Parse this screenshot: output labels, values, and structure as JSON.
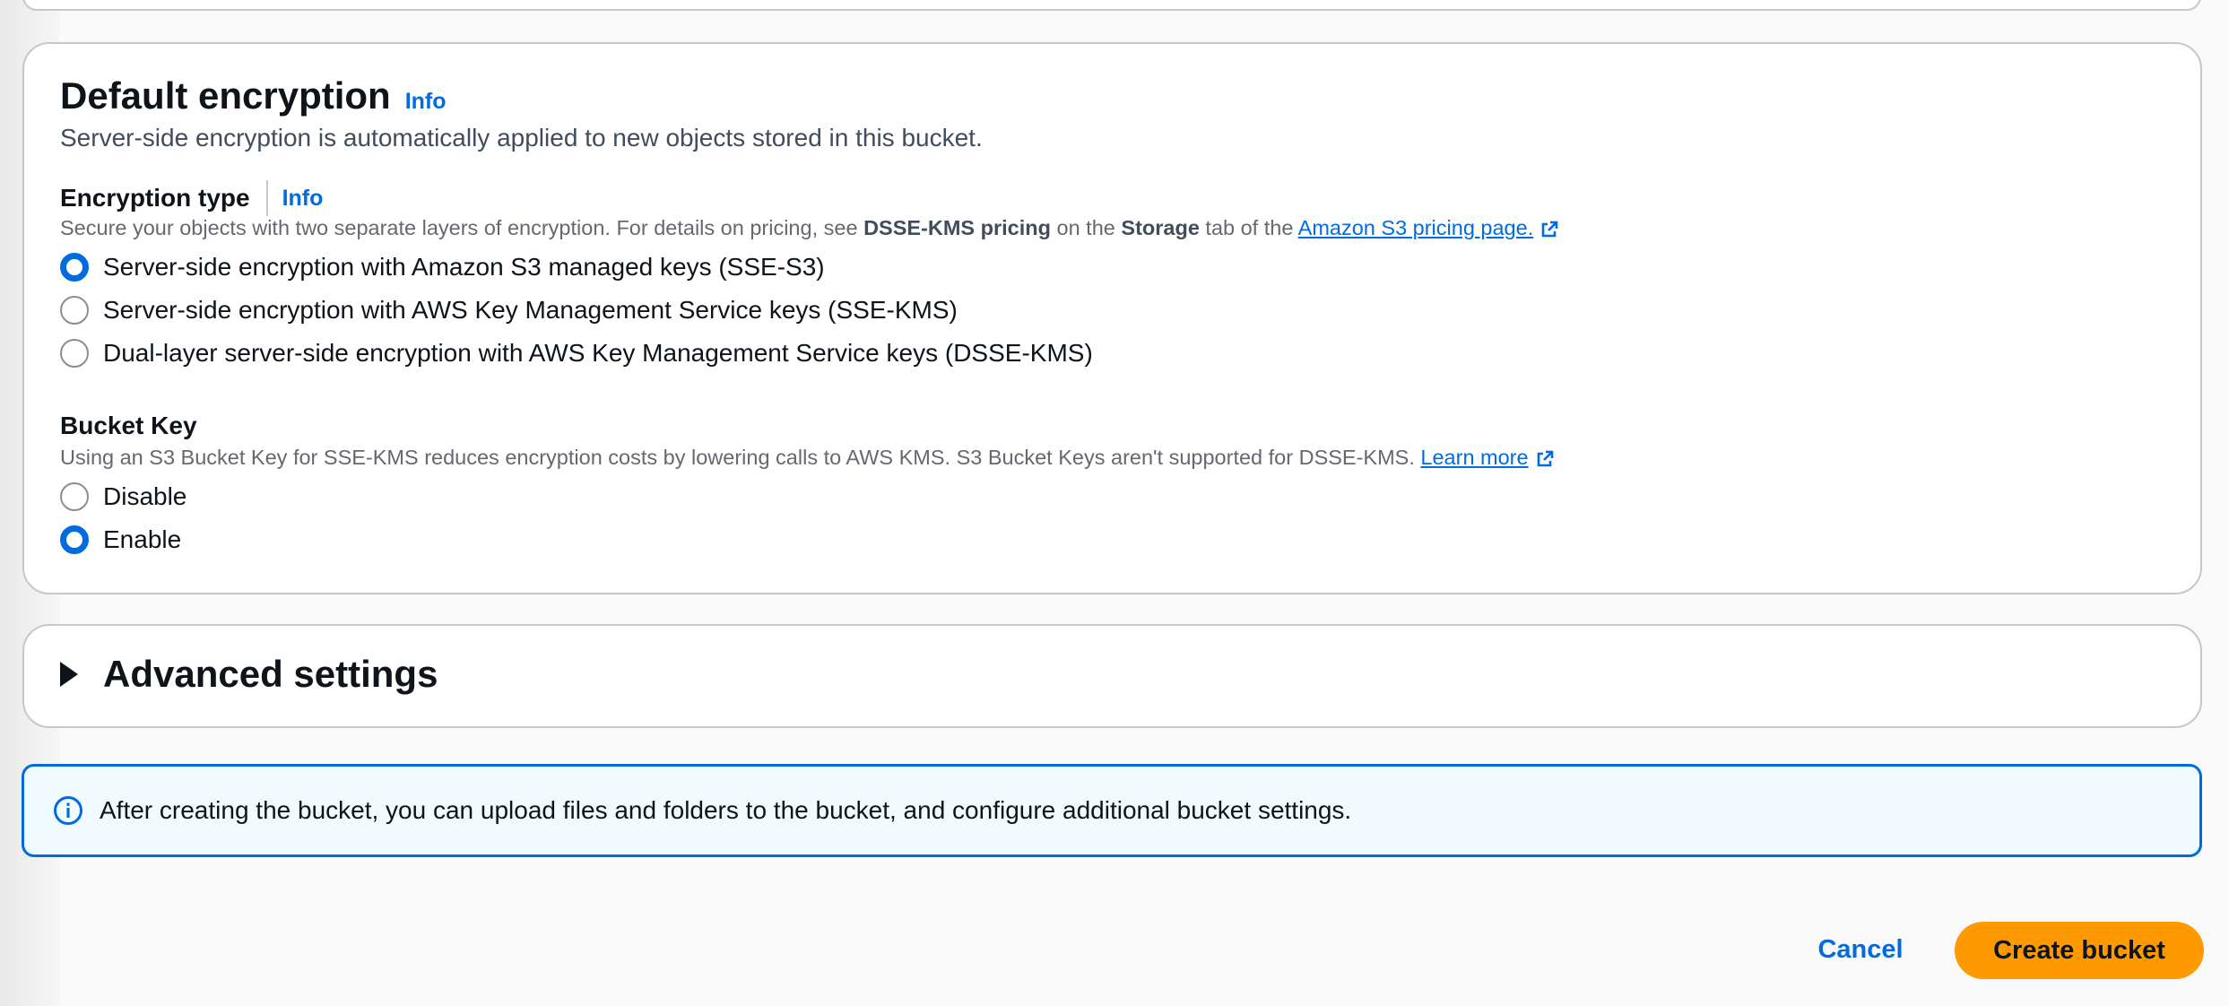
{
  "encryption": {
    "title": "Default encryption",
    "info": "Info",
    "description": "Server-side encryption is automatically applied to new objects stored in this bucket.",
    "type_label": "Encryption type",
    "type_info": "Info",
    "type_desc": {
      "part1": "Secure your objects with two separate layers of encryption. For details on pricing, see ",
      "bold1": "DSSE-KMS pricing",
      "part2": " on the ",
      "bold2": "Storage",
      "part3": " tab of the ",
      "link": "Amazon S3 pricing page."
    },
    "options": [
      {
        "label": "Server-side encryption with Amazon S3 managed keys (SSE-S3)",
        "checked": true
      },
      {
        "label": "Server-side encryption with AWS Key Management Service keys (SSE-KMS)",
        "checked": false
      },
      {
        "label": "Dual-layer server-side encryption with AWS Key Management Service keys (DSSE-KMS)",
        "checked": false
      }
    ],
    "bucket_key": {
      "label": "Bucket Key",
      "desc": "Using an S3 Bucket Key for SSE-KMS reduces encryption costs by lowering calls to AWS KMS. S3 Bucket Keys aren't supported for DSSE-KMS. ",
      "link": "Learn more",
      "options": [
        {
          "label": "Disable",
          "checked": false
        },
        {
          "label": "Enable",
          "checked": true
        }
      ]
    }
  },
  "advanced": {
    "title": "Advanced settings"
  },
  "alert": {
    "text": "After creating the bucket, you can upload files and folders to the bucket, and configure additional bucket settings."
  },
  "actions": {
    "cancel": "Cancel",
    "create": "Create bucket"
  },
  "colors": {
    "primary_link": "#006ce0",
    "primary_button": "#ff9900",
    "alert_bg": "#f0fbff"
  }
}
